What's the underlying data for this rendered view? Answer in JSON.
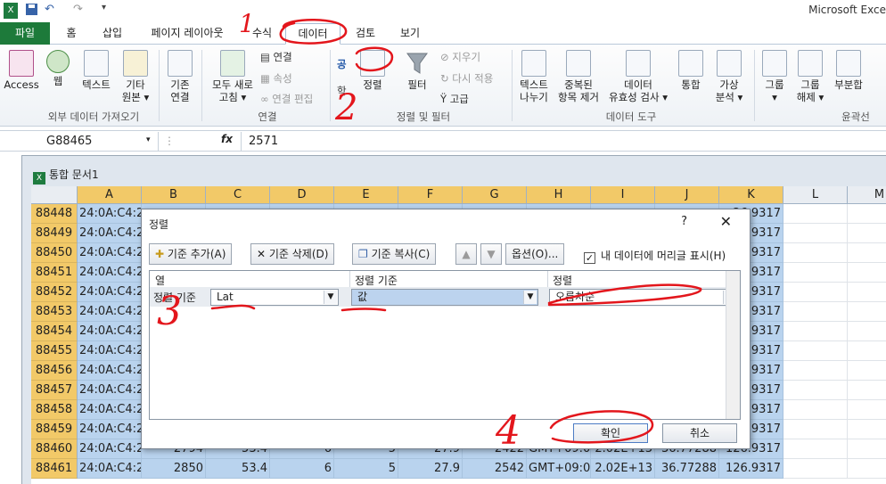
{
  "titlebar": {
    "app_title": "Microsoft Exce",
    "undo": "↶",
    "redo": "↷"
  },
  "tabs": [
    "파일",
    "홈",
    "삽입",
    "페이지 레이아웃",
    "수식",
    "데이터",
    "검토",
    "보기"
  ],
  "ribbon": {
    "access": "Access",
    "web": "웹",
    "text": "텍스트",
    "other_line1": "기타",
    "other_line2": "원본 ▾",
    "existing_line1": "기존",
    "existing_line2": "연결",
    "refresh_line1": "모두 새로",
    "refresh_line2": "고침 ▾",
    "connections": "연결",
    "properties": "속성",
    "edit_links": "연결 편집",
    "sort_asc": "공",
    "sort_desc": "학",
    "sort": "정렬",
    "filter": "필터",
    "clear": "지우기",
    "reapply": "다시 적용",
    "advanced": "고급",
    "text_to_columns_1": "텍스트",
    "text_to_columns_2": "나누기",
    "remove_dup_1": "중복된",
    "remove_dup_2": "항목 제거",
    "validation_1": "데이터",
    "validation_2": "유효성 검사 ▾",
    "consolidate": "통합",
    "whatif_1": "가상",
    "whatif_2": "분석 ▾",
    "group": "그룹",
    "group_arrow": "▾",
    "ungroup_1": "그룹",
    "ungroup_2": "해제 ▾",
    "subtotal": "부분합",
    "groups": {
      "external": "외부 데이터 가져오기",
      "connections": "연결",
      "sortfilter": "정렬 및 필터",
      "datatools": "데이터 도구",
      "outline": "윤곽선"
    }
  },
  "formula_bar": {
    "name_box": "G88465",
    "fx": "fx",
    "value": "2571"
  },
  "workbook": {
    "title": "통합 문서1",
    "columns": [
      "A",
      "B",
      "C",
      "D",
      "E",
      "F",
      "G",
      "H",
      "I",
      "J",
      "K",
      "L",
      "M"
    ],
    "rows": [
      {
        "n": "88448",
        "a": "24:0A:C4:2",
        "k": "26.9317"
      },
      {
        "n": "88449",
        "a": "24:0A:C4:2",
        "k": "26.9317"
      },
      {
        "n": "88450",
        "a": "24:0A:C4:2",
        "k": "26.9317"
      },
      {
        "n": "88451",
        "a": "24:0A:C4:2",
        "k": "26.9317"
      },
      {
        "n": "88452",
        "a": "24:0A:C4:2",
        "k": "26.9317"
      },
      {
        "n": "88453",
        "a": "24:0A:C4:2",
        "k": "26.9317"
      },
      {
        "n": "88454",
        "a": "24:0A:C4:2",
        "k": "26.9317"
      },
      {
        "n": "88455",
        "a": "24:0A:C4:2",
        "k": "26.9317"
      },
      {
        "n": "88456",
        "a": "24:0A:C4:2",
        "k": "26.9317"
      },
      {
        "n": "88457",
        "a": "24:0A:C4:2",
        "k": "26.9317"
      },
      {
        "n": "88458",
        "a": "24:0A:C4:2",
        "k": "26.9317"
      },
      {
        "n": "88459",
        "a": "24:0A:C4:2",
        "k": "26.9317"
      },
      {
        "n": "88460",
        "a": "24:0A:C4:2",
        "b": "2794",
        "c": "53.4",
        "d": "6",
        "e": "5",
        "f": "27.9",
        "g": "2422",
        "h": "GMT+09:0",
        "i": "2.02E+13",
        "j": "36.77288",
        "k": "126.9317"
      },
      {
        "n": "88461",
        "a": "24:0A:C4:2",
        "b": "2850",
        "c": "53.4",
        "d": "6",
        "e": "5",
        "f": "27.9",
        "g": "2542",
        "h": "GMT+09:0",
        "i": "2.02E+13",
        "j": "36.77288",
        "k": "126.9317"
      }
    ]
  },
  "dialog": {
    "title": "정렬",
    "help": "?",
    "close": "✕",
    "add_level": "기준 추가(A)",
    "delete_level": "기준 삭제(D)",
    "copy_level": "기준 복사(C)",
    "options": "옵션(O)...",
    "header_checkbox": "내 데이터에 머리글 표시(H)",
    "header_checked": true,
    "col_header": "열",
    "sorton_header": "정렬 기준",
    "order_header": "정렬",
    "row_label": "정렬 기준",
    "column_value": "Lat",
    "sorton_value": "값",
    "order_value": "오름차순",
    "ok": "확인",
    "cancel": "취소"
  },
  "annotations": [
    "1",
    "2",
    "3",
    "4"
  ],
  "colors": {
    "file_tab": "#1d7a3a",
    "selected_header": "#f2c968",
    "selection": "#b9d3ee",
    "annotation": "#e3161c"
  }
}
